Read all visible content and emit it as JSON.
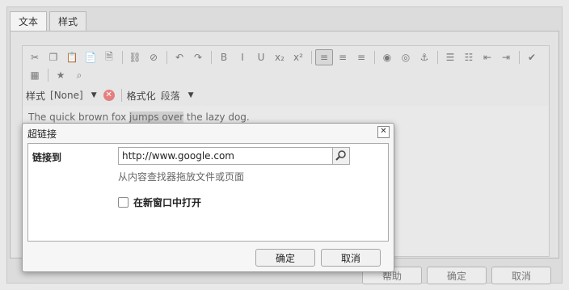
{
  "tabs": [
    {
      "label": "文本",
      "active": true
    },
    {
      "label": "样式",
      "active": false
    }
  ],
  "toolbar": {
    "row1": [
      {
        "icon": "cut-icon",
        "glyph": "✂"
      },
      {
        "icon": "copy-icon",
        "glyph": "❐"
      },
      {
        "icon": "paste-icon",
        "glyph": "📋"
      },
      {
        "icon": "paste-text-icon",
        "glyph": "📄"
      },
      {
        "icon": "paste-word-icon",
        "glyph": "🗎"
      },
      {
        "sep": true
      },
      {
        "icon": "link-icon",
        "glyph": "⛓"
      },
      {
        "icon": "unlink-icon",
        "glyph": "⊘"
      },
      {
        "sep": true
      },
      {
        "icon": "undo-icon",
        "glyph": "↶"
      },
      {
        "icon": "redo-icon",
        "glyph": "↷"
      },
      {
        "sep": true
      },
      {
        "icon": "bold-icon",
        "glyph": "B"
      },
      {
        "icon": "italic-icon",
        "glyph": "I"
      },
      {
        "icon": "underline-icon",
        "glyph": "U"
      },
      {
        "icon": "subscript-icon",
        "glyph": "x₂"
      },
      {
        "icon": "superscript-icon",
        "glyph": "x²"
      },
      {
        "sep": true
      },
      {
        "icon": "align-left-icon",
        "glyph": "≡",
        "selected": true
      },
      {
        "icon": "align-center-icon",
        "glyph": "≡"
      },
      {
        "icon": "align-right-icon",
        "glyph": "≡"
      },
      {
        "sep": true
      },
      {
        "icon": "image-icon",
        "glyph": "◉"
      },
      {
        "icon": "image-map-icon",
        "glyph": "◎"
      },
      {
        "icon": "anchor-icon",
        "glyph": "⚓"
      },
      {
        "sep": true
      },
      {
        "icon": "bullet-list-icon",
        "glyph": "☰"
      },
      {
        "icon": "numbered-list-icon",
        "glyph": "☷"
      },
      {
        "icon": "outdent-icon",
        "glyph": "⇤"
      },
      {
        "icon": "indent-icon",
        "glyph": "⇥"
      },
      {
        "sep": true
      },
      {
        "icon": "spellcheck-icon",
        "glyph": "✔"
      }
    ],
    "row2": [
      {
        "icon": "table-icon",
        "glyph": "▦"
      },
      {
        "sep": true
      },
      {
        "icon": "special-char-icon",
        "glyph": "★"
      },
      {
        "icon": "find-replace-icon",
        "glyph": "⌕"
      }
    ]
  },
  "format_bar": {
    "style_label": "样式",
    "style_value": "[None]",
    "format_label": "格式化",
    "format_value": "段落"
  },
  "content": {
    "before": "The quick brown fox ",
    "highlight": "jumps over",
    "after": " the lazy dog."
  },
  "dialog": {
    "title": "超链接",
    "link_label": "链接到",
    "url_value": "http://www.google.com",
    "hint": "从内容查找器拖放文件或页面",
    "new_window_label": "在新窗口中打开",
    "new_window_checked": false,
    "ok": "确定",
    "cancel": "取消"
  },
  "footer": {
    "help": "帮助",
    "ok": "确定",
    "cancel": "取消"
  }
}
